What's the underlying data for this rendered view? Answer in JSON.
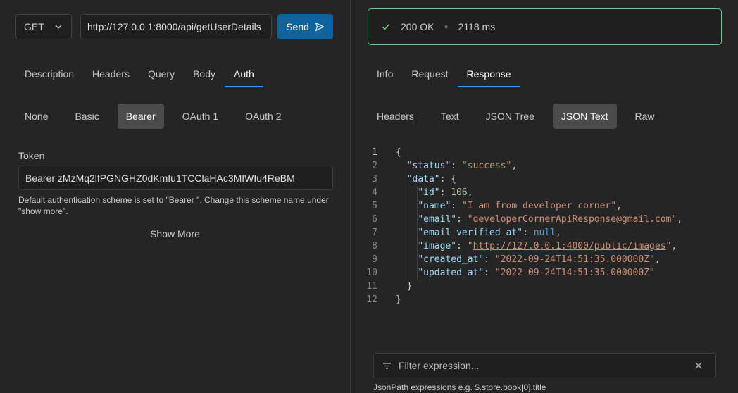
{
  "request": {
    "method": "GET",
    "url": "http://127.0.0.1:8000/api/getUserDetails",
    "send_label": "Send"
  },
  "request_tabs": [
    {
      "label": "Description",
      "active": false
    },
    {
      "label": "Headers",
      "active": false
    },
    {
      "label": "Query",
      "active": false
    },
    {
      "label": "Body",
      "active": false
    },
    {
      "label": "Auth",
      "active": true
    }
  ],
  "auth_types": [
    {
      "label": "None",
      "active": false
    },
    {
      "label": "Basic",
      "active": false
    },
    {
      "label": "Bearer",
      "active": true
    },
    {
      "label": "OAuth 1",
      "active": false
    },
    {
      "label": "OAuth 2",
      "active": false
    }
  ],
  "auth": {
    "token_label": "Token",
    "token_value": "Bearer zMzMq2lfPGNGHZ0dKmIu1TCClaHAc3MIWIu4ReBM",
    "hint": "Default authentication scheme is set to \"Bearer \". Change this scheme name under \"show more\".",
    "show_more": "Show More"
  },
  "response": {
    "status_text": "200 OK",
    "time": "2118 ms",
    "status_color": "#73c991"
  },
  "response_tabs": [
    {
      "label": "Info",
      "active": false
    },
    {
      "label": "Request",
      "active": false
    },
    {
      "label": "Response",
      "active": true
    }
  ],
  "view_tabs": [
    {
      "label": "Headers",
      "active": false
    },
    {
      "label": "Text",
      "active": false
    },
    {
      "label": "JSON Tree",
      "active": false
    },
    {
      "label": "JSON Text",
      "active": true
    },
    {
      "label": "Raw",
      "active": false
    }
  ],
  "json_lines": [
    {
      "n": "1",
      "indent": 0,
      "parts": [
        {
          "t": "{",
          "c": "txt"
        }
      ]
    },
    {
      "n": "2",
      "indent": 1,
      "parts": [
        {
          "t": "\"status\"",
          "c": "k"
        },
        {
          "t": ": ",
          "c": "txt"
        },
        {
          "t": "\"success\"",
          "c": "s"
        },
        {
          "t": ",",
          "c": "txt"
        }
      ]
    },
    {
      "n": "3",
      "indent": 1,
      "parts": [
        {
          "t": "\"data\"",
          "c": "k"
        },
        {
          "t": ": {",
          "c": "txt"
        }
      ]
    },
    {
      "n": "4",
      "indent": 2,
      "parts": [
        {
          "t": "\"id\"",
          "c": "k"
        },
        {
          "t": ": ",
          "c": "txt"
        },
        {
          "t": "106",
          "c": "n"
        },
        {
          "t": ",",
          "c": "txt"
        }
      ]
    },
    {
      "n": "5",
      "indent": 2,
      "parts": [
        {
          "t": "\"name\"",
          "c": "k"
        },
        {
          "t": ": ",
          "c": "txt"
        },
        {
          "t": "\"I am from developer corner\"",
          "c": "s"
        },
        {
          "t": ",",
          "c": "txt"
        }
      ]
    },
    {
      "n": "6",
      "indent": 2,
      "parts": [
        {
          "t": "\"email\"",
          "c": "k"
        },
        {
          "t": ": ",
          "c": "txt"
        },
        {
          "t": "\"developerCornerApiResponse@gmail.com\"",
          "c": "s"
        },
        {
          "t": ",",
          "c": "txt"
        }
      ]
    },
    {
      "n": "7",
      "indent": 2,
      "parts": [
        {
          "t": "\"email_verified_at\"",
          "c": "k"
        },
        {
          "t": ": ",
          "c": "txt"
        },
        {
          "t": "null",
          "c": "nul"
        },
        {
          "t": ",",
          "c": "txt"
        }
      ]
    },
    {
      "n": "8",
      "indent": 2,
      "parts": [
        {
          "t": "\"image\"",
          "c": "k"
        },
        {
          "t": ": ",
          "c": "txt"
        },
        {
          "t": "\"",
          "c": "s"
        },
        {
          "t": "http://127.0.0.1:4000/public/images",
          "c": "lnk"
        },
        {
          "t": "\"",
          "c": "s"
        },
        {
          "t": ",",
          "c": "txt"
        }
      ]
    },
    {
      "n": "9",
      "indent": 2,
      "parts": [
        {
          "t": "\"created_at\"",
          "c": "k"
        },
        {
          "t": ": ",
          "c": "txt"
        },
        {
          "t": "\"2022-09-24T14:51:35.000000Z\"",
          "c": "s"
        },
        {
          "t": ",",
          "c": "txt"
        }
      ]
    },
    {
      "n": "10",
      "indent": 2,
      "parts": [
        {
          "t": "\"updated_at\"",
          "c": "k"
        },
        {
          "t": ": ",
          "c": "txt"
        },
        {
          "t": "\"2022-09-24T14:51:35.000000Z\"",
          "c": "s"
        }
      ]
    },
    {
      "n": "11",
      "indent": 1,
      "parts": [
        {
          "t": "}",
          "c": "txt"
        }
      ]
    },
    {
      "n": "12",
      "indent": 0,
      "parts": [
        {
          "t": "}",
          "c": "txt"
        }
      ]
    }
  ],
  "filter": {
    "placeholder": "Filter expression...",
    "hint": "JsonPath expressions e.g. $.store.book[0].title"
  },
  "icons": {
    "method_dropdown": "chevron-down-icon",
    "send": "send-icon",
    "status": "check-icon",
    "filter": "filter-icon",
    "clear": "close-icon"
  }
}
